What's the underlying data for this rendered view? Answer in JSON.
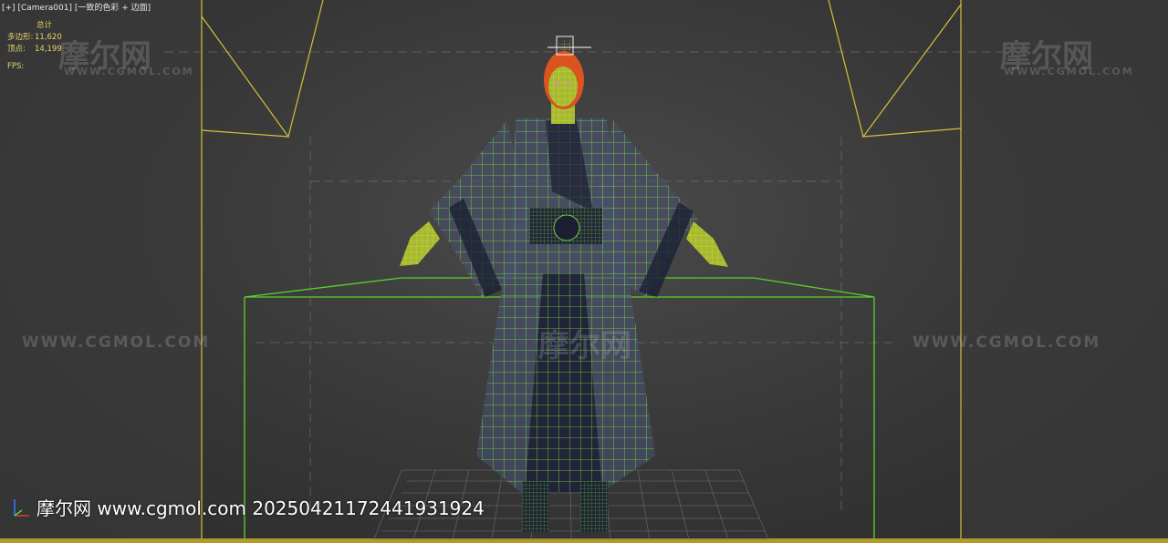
{
  "viewport": {
    "label_plus": "[+]",
    "label_camera": "[Camera001]",
    "label_shading": "[一致的色彩 + 边面]"
  },
  "stats": {
    "title": "总计",
    "polygons_label": "多边形:",
    "polygons_value": "11,620",
    "vertices_label": "顶点:",
    "vertices_value": "14,199",
    "fps_label": "FPS:"
  },
  "watermarks": {
    "logo_text": "摩尔网",
    "url_text": "WWW.CGMOL.COM"
  },
  "footer": {
    "text": "摩尔网 www.cgmol.com 20250421172441931924"
  },
  "colors": {
    "wire_green": "#7cff3a",
    "safe_frame_yellow": "#d6c13a",
    "grid_gray": "#6e6e6e",
    "skin_yellow": "#a8b830",
    "hair_orange": "#d9541f",
    "robe_dark": "#1c1f33",
    "robe_mid": "#4a5070"
  }
}
